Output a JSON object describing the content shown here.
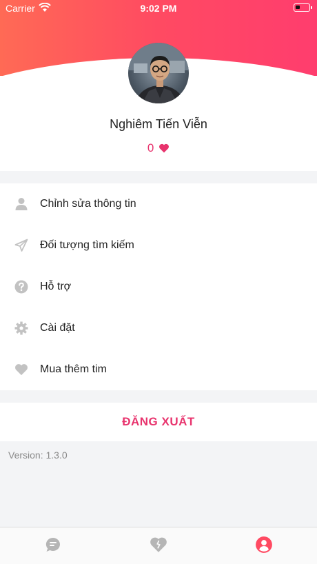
{
  "status_bar": {
    "carrier": "Carrier",
    "time": "9:02 PM"
  },
  "profile": {
    "name": "Nghiêm Tiến Viễn",
    "likes": "0"
  },
  "menu": {
    "items": [
      {
        "label": "Chỉnh sửa thông tin",
        "icon": "user-icon"
      },
      {
        "label": "Đối tượng tìm kiếm",
        "icon": "paper-plane-icon"
      },
      {
        "label": "Hỗ trợ",
        "icon": "question-circle-icon"
      },
      {
        "label": "Cài đặt",
        "icon": "gear-icon"
      },
      {
        "label": "Mua thêm tim",
        "icon": "heart-icon"
      }
    ]
  },
  "logout_label": "ĐĂNG XUẤT",
  "version": "Version: 1.3.0",
  "tabbar": {
    "tabs": [
      {
        "icon": "chat-icon",
        "active": false
      },
      {
        "icon": "heart-icon",
        "active": false
      },
      {
        "icon": "profile-icon",
        "active": true
      }
    ]
  },
  "colors": {
    "accent": "#e8336d",
    "header_start": "#ff6a55",
    "header_end": "#ff3d6e",
    "inactive_icon": "#b5b5b5"
  }
}
